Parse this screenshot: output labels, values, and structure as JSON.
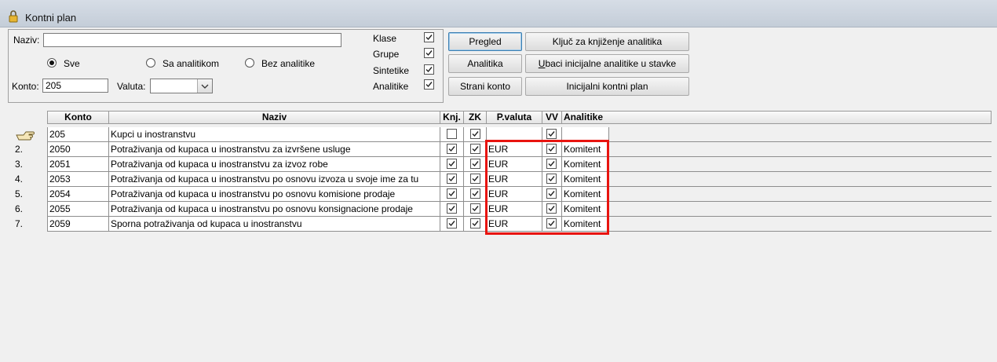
{
  "window": {
    "title": "Kontni plan"
  },
  "filters": {
    "naziv_label": "Naziv:",
    "naziv_value": "",
    "radio_sve": "Sve",
    "radio_sa": "Sa analitikom",
    "radio_bez": "Bez analitike",
    "radio_selected": "Sve",
    "konto_label": "Konto:",
    "konto_value": "205",
    "valuta_label": "Valuta:",
    "valuta_value": "",
    "klase": "Klase",
    "grupe": "Grupe",
    "sintetike": "Sintetike",
    "analitike": "Analitike"
  },
  "buttons": {
    "pregled": "Pregled",
    "analitika": "Analitika",
    "strani_konto": "Strani konto",
    "kljuc": "Ključ za knjiženje analitika",
    "ubaci_prefix": "U",
    "ubaci_rest": "baci inicijalne analitike u stavke",
    "inicijalni": "Inicijalni kontni plan"
  },
  "table": {
    "headers": {
      "konto": "Konto",
      "naziv": "Naziv",
      "knj": "Knj.",
      "zk": "ZK",
      "pvaluta": "P.valuta",
      "vv": "VV",
      "analitike": "Analitike"
    },
    "rows": [
      {
        "ind": "",
        "konto": "205",
        "naziv": "Kupci u inostranstvu",
        "knj": false,
        "zk": true,
        "pvaluta": "",
        "vv": true,
        "analitike": ""
      },
      {
        "ind": "2.",
        "konto": "2050",
        "naziv": "Potraživanja od kupaca u inostranstvu za izvršene usluge",
        "knj": true,
        "zk": true,
        "pvaluta": "EUR",
        "vv": true,
        "analitike": "Komitent"
      },
      {
        "ind": "3.",
        "konto": "2051",
        "naziv": "Potraživanja od kupaca u inostranstvu za izvoz robe",
        "knj": true,
        "zk": true,
        "pvaluta": "EUR",
        "vv": true,
        "analitike": "Komitent"
      },
      {
        "ind": "4.",
        "konto": "2053",
        "naziv": "Potraživanja od kupaca u inostranstvu po osnovu izvoza u svoje ime za tu",
        "knj": true,
        "zk": true,
        "pvaluta": "EUR",
        "vv": true,
        "analitike": "Komitent"
      },
      {
        "ind": "5.",
        "konto": "2054",
        "naziv": "Potraživanja od kupaca u inostranstvu po osnovu komisione prodaje",
        "knj": true,
        "zk": true,
        "pvaluta": "EUR",
        "vv": true,
        "analitike": "Komitent"
      },
      {
        "ind": "6.",
        "konto": "2055",
        "naziv": "Potraživanja od kupaca u inostranstvu po osnovu konsignacione prodaje",
        "knj": true,
        "zk": true,
        "pvaluta": "EUR",
        "vv": true,
        "analitike": "Komitent"
      },
      {
        "ind": "7.",
        "konto": "2059",
        "naziv": "Sporna potraživanja od kupaca u inostranstvu",
        "knj": true,
        "zk": true,
        "pvaluta": "EUR",
        "vv": true,
        "analitike": "Komitent"
      }
    ]
  },
  "colors": {
    "highlight": "#e8140f"
  }
}
